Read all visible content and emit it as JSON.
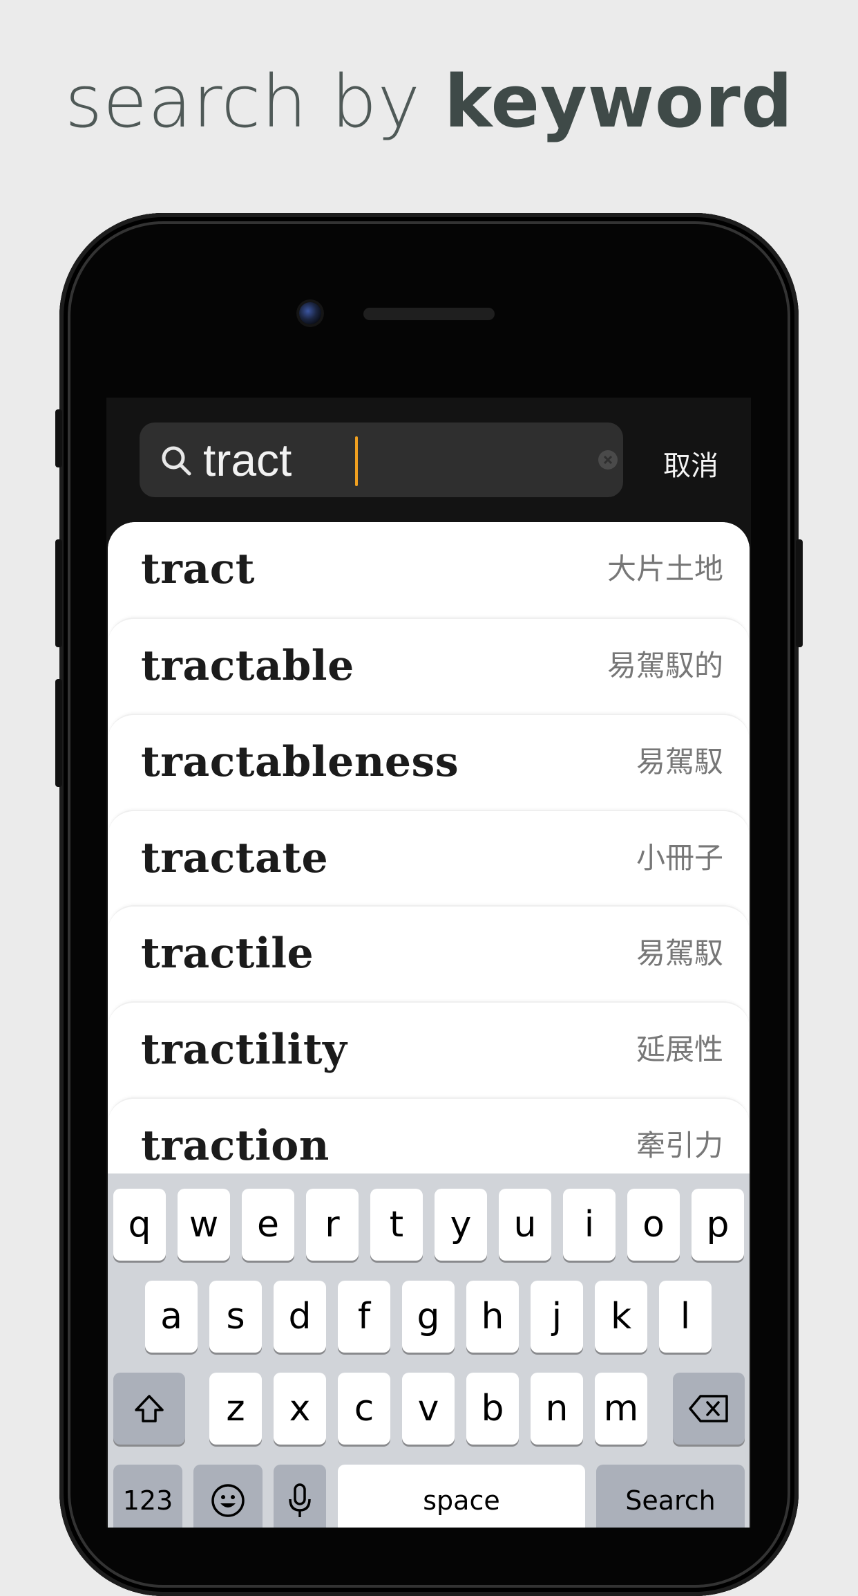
{
  "headline": {
    "light": "search by",
    "bold": "keyword"
  },
  "search": {
    "value": "tract",
    "cancel_label": "取消"
  },
  "results": [
    {
      "word": "tract",
      "meaning": "大片土地"
    },
    {
      "word": "tractable",
      "meaning": "易駕馭的"
    },
    {
      "word": "tractableness",
      "meaning": "易駕馭"
    },
    {
      "word": "tractate",
      "meaning": "小冊子"
    },
    {
      "word": "tractile",
      "meaning": "易駕馭"
    },
    {
      "word": "tractility",
      "meaning": "延展性"
    },
    {
      "word": "traction",
      "meaning": "牽引力"
    }
  ],
  "keyboard": {
    "row1": [
      "q",
      "w",
      "e",
      "r",
      "t",
      "y",
      "u",
      "i",
      "o",
      "p"
    ],
    "row2": [
      "a",
      "s",
      "d",
      "f",
      "g",
      "h",
      "j",
      "k",
      "l"
    ],
    "row3": [
      "z",
      "x",
      "c",
      "v",
      "b",
      "n",
      "m"
    ],
    "numbers_label": "123",
    "space_label": "space",
    "search_label": "Search"
  },
  "icons": {
    "search": "search-icon",
    "clear": "clear-icon",
    "shift": "shift-icon",
    "delete": "backspace-icon",
    "emoji": "emoji-icon",
    "mic": "microphone-icon"
  }
}
